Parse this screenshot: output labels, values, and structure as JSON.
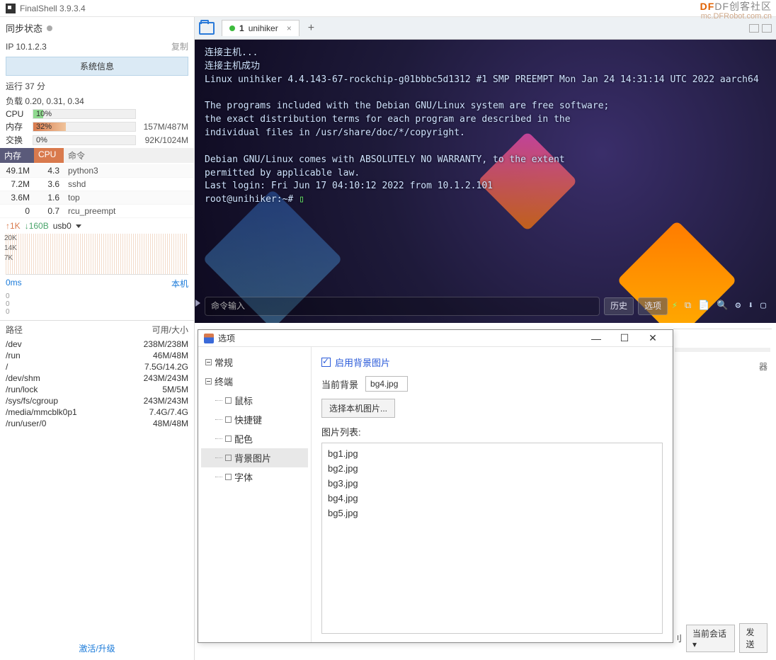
{
  "app": {
    "title": "FinalShell 3.9.3.4"
  },
  "watermark": {
    "line1": "DF创客社区",
    "line2": "mc.DFRobot.com.cn"
  },
  "sidebar": {
    "sync_label": "同步状态",
    "ip_label": "IP 10.1.2.3",
    "copy": "复制",
    "sysinfo_btn": "系统信息",
    "runtime": "运行 37 分",
    "load": "负载 0.20, 0.31, 0.34",
    "cpu": {
      "label": "CPU",
      "pct": "10%",
      "width": "10%"
    },
    "mem": {
      "label": "内存",
      "pct": "32%",
      "width": "32%",
      "txt": "157M/487M"
    },
    "swap": {
      "label": "交换",
      "pct": "0%",
      "txt": "92K/1024M"
    },
    "proc_header": {
      "mem": "内存",
      "cpu": "CPU",
      "cmd": "命令"
    },
    "procs": [
      {
        "mem": "49.1M",
        "cpu": "4.3",
        "cmd": "python3"
      },
      {
        "mem": "7.2M",
        "cpu": "3.6",
        "cmd": "sshd"
      },
      {
        "mem": "3.6M",
        "cpu": "1.6",
        "cmd": "top"
      },
      {
        "mem": "0",
        "cpu": "0.7",
        "cmd": "rcu_preempt"
      }
    ],
    "net": {
      "up": "↑1K",
      "down": "↓160B",
      "iface": "usb0"
    },
    "chart_y": [
      "20K",
      "14K",
      "7K"
    ],
    "lat": {
      "val": "0ms",
      "host": "本机",
      "scale": [
        "0",
        "0",
        "0"
      ]
    },
    "path_header": {
      "p": "路径",
      "s": "可用/大小"
    },
    "paths": [
      {
        "p": "/dev",
        "s": "238M/238M"
      },
      {
        "p": "/run",
        "s": "46M/48M"
      },
      {
        "p": "/",
        "s": "7.5G/14.2G"
      },
      {
        "p": "/dev/shm",
        "s": "243M/243M"
      },
      {
        "p": "/run/lock",
        "s": "5M/5M"
      },
      {
        "p": "/sys/fs/cgroup",
        "s": "243M/243M"
      },
      {
        "p": "/media/mmcblk0p1",
        "s": "7.4G/7.4G"
      },
      {
        "p": "/run/user/0",
        "s": "48M/48M"
      }
    ],
    "activate": "激活/升级"
  },
  "tabs": {
    "tab1_num": "1",
    "tab1_name": "unihiker",
    "close": "×",
    "plus": "+"
  },
  "terminal": {
    "lines": "连接主机...\n连接主机成功\nLinux unihiker 4.4.143-67-rockchip-g01bbbc5d1312 #1 SMP PREEMPT Mon Jan 24 14:31:14 UTC 2022 aarch64\n\nThe programs included with the Debian GNU/Linux system are free software;\nthe exact distribution terms for each program are described in the\nindividual files in /usr/share/doc/*/copyright.\n\nDebian GNU/Linux comes with ABSOLUTELY NO WARRANTY, to the extent\npermitted by applicable law.\nLast login: Fri Jun 17 04:10:12 2022 from 10.1.2.101",
    "prompt": "root@unihiker:~# ",
    "cmd_placeholder": "命令输入",
    "btn_history": "历史",
    "btn_opts": "选项"
  },
  "dialog": {
    "title": "选项",
    "win": {
      "min": "—",
      "max": "☐",
      "close": "✕"
    },
    "tree": {
      "general": "常规",
      "terminal": "终端",
      "mouse": "鼠标",
      "shortcut": "快捷键",
      "color": "配色",
      "bgimg": "背景图片",
      "font": "字体"
    },
    "pane": {
      "enable_label": "启用背景图片",
      "current_label": "当前背景",
      "current_value": "bg4.jpg",
      "choose_btn": "选择本机图片...",
      "list_label": "图片列表:",
      "items": [
        "bg1.jpg",
        "bg2.jpg",
        "bg3.jpg",
        "bg4.jpg",
        "bg5.jpg"
      ]
    }
  },
  "bottom": {
    "badge": "器",
    "trunc": "刂",
    "session": "当前会话 ▾",
    "send": "发送"
  }
}
